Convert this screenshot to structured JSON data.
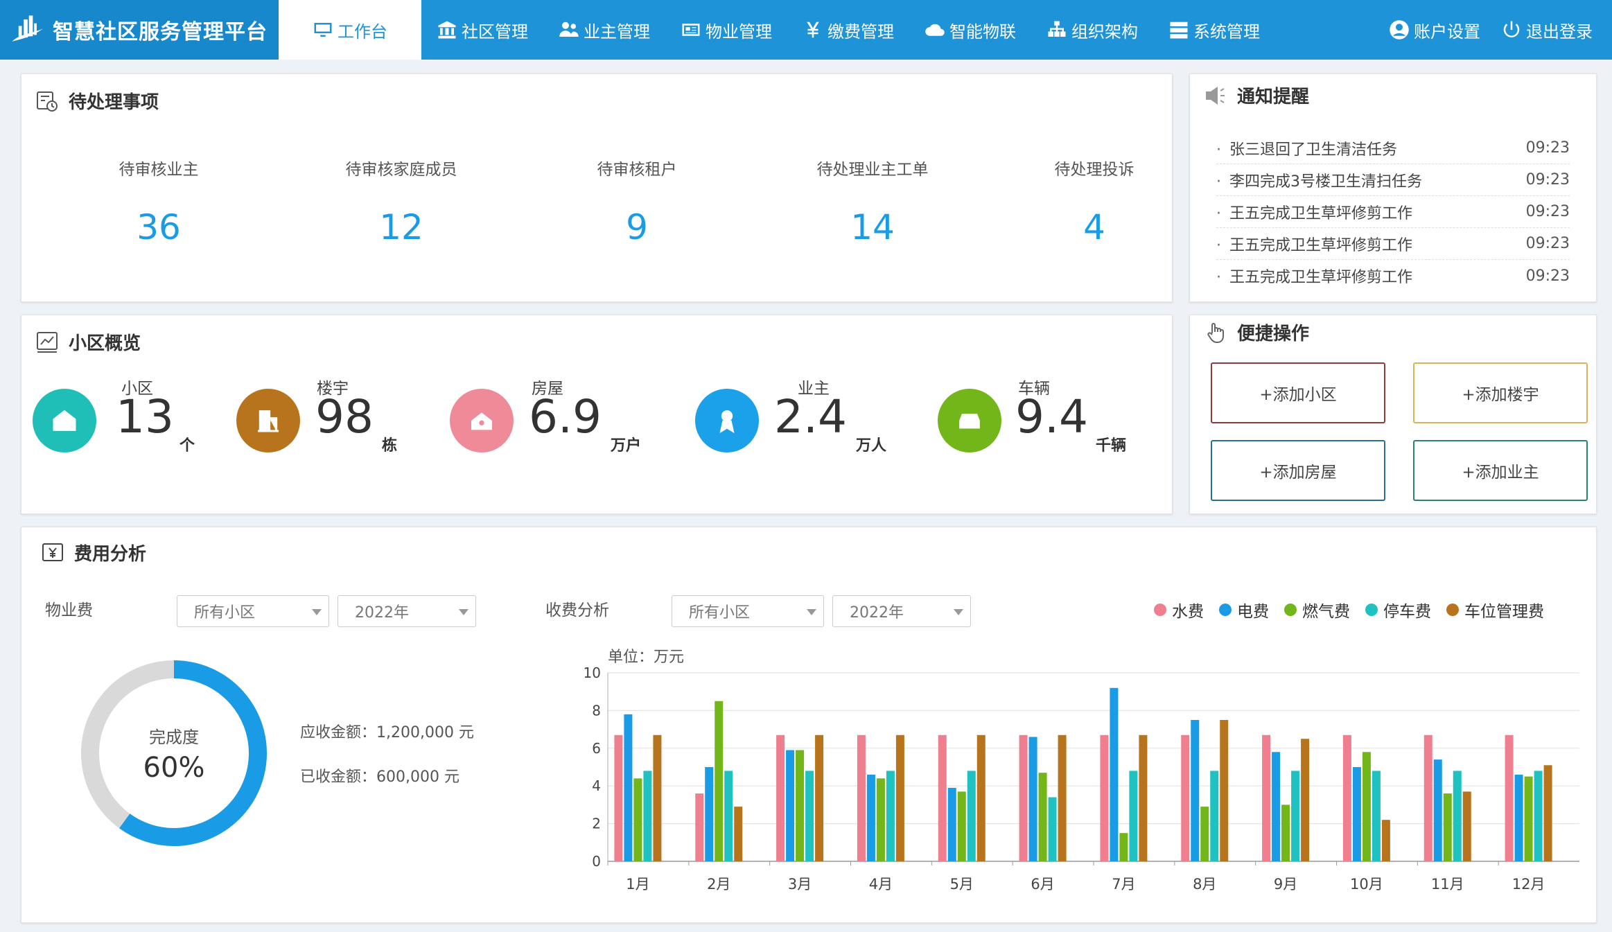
{
  "brand": {
    "title": "智慧社区服务管理平台"
  },
  "nav": {
    "items": [
      {
        "label": "工作台",
        "icon": "monitor-icon",
        "active": true
      },
      {
        "label": "社区管理",
        "icon": "bank-icon"
      },
      {
        "label": "业主管理",
        "icon": "users-icon"
      },
      {
        "label": "物业管理",
        "icon": "newspaper-icon"
      },
      {
        "label": "缴费管理",
        "icon": "yen-icon"
      },
      {
        "label": "智能物联",
        "icon": "cloud-icon"
      },
      {
        "label": "组织架构",
        "icon": "sitemap-icon"
      },
      {
        "label": "系统管理",
        "icon": "server-icon"
      }
    ],
    "account": "账户设置",
    "logout": "退出登录"
  },
  "pending": {
    "title": "待处理事项",
    "items": [
      {
        "label": "待审核业主",
        "value": "36"
      },
      {
        "label": "待审核家庭成员",
        "value": "12"
      },
      {
        "label": "待审核租户",
        "value": "9"
      },
      {
        "label": "待处理业主工单",
        "value": "14"
      },
      {
        "label": "待处理投诉",
        "value": "4"
      }
    ]
  },
  "notice": {
    "title": "通知提醒",
    "items": [
      {
        "text": "张三退回了卫生清洁任务",
        "time": "09:23"
      },
      {
        "text": "李四完成3号楼卫生清扫任务",
        "time": "09:23"
      },
      {
        "text": "王五完成卫生草坪修剪工作",
        "time": "09:23"
      },
      {
        "text": "王五完成卫生草坪修剪工作",
        "time": "09:23"
      },
      {
        "text": "王五完成卫生草坪修剪工作",
        "time": "09:23"
      }
    ]
  },
  "overview": {
    "title": "小区概览",
    "items": [
      {
        "label": "小区",
        "value": "13",
        "unit": "个",
        "color": "#1fbfb8",
        "icon": "home-icon"
      },
      {
        "label": "楼宇",
        "value": "98",
        "unit": "栋",
        "color": "#b8741c",
        "icon": "building-icon"
      },
      {
        "label": "房屋",
        "value": "6.9",
        "unit": "万户",
        "color": "#ef8a98",
        "icon": "house-icon"
      },
      {
        "label": "业主",
        "value": "2.4",
        "unit": "万人",
        "color": "#1aa1ea",
        "icon": "person-icon"
      },
      {
        "label": "车辆",
        "value": "9.4",
        "unit": "千辆",
        "color": "#72b61a",
        "icon": "car-icon"
      }
    ]
  },
  "quick": {
    "title": "便捷操作",
    "buttons": [
      {
        "label": "+添加小区",
        "color": "#8c3a3a"
      },
      {
        "label": "+添加楼宇",
        "color": "#d9b45a"
      },
      {
        "label": "+添加房屋",
        "color": "#2a6d8c"
      },
      {
        "label": "+添加业主",
        "color": "#2a7f78"
      }
    ]
  },
  "fees": {
    "title": "费用分析",
    "property_label": "物业费",
    "community_select": "所有小区",
    "year_select": "2022年",
    "donut": {
      "label": "完成度",
      "value_text": "60%",
      "percent": 60
    },
    "receivable": "应收金额：1,200,000 元",
    "received": "已收金额：600,000 元",
    "collection_label": "收费分析",
    "community_select2": "所有小区",
    "year_select2": "2022年",
    "unit_label": "单位：万元"
  },
  "chart_data": {
    "type": "bar",
    "categories": [
      "1月",
      "2月",
      "3月",
      "4月",
      "5月",
      "6月",
      "7月",
      "8月",
      "9月",
      "10月",
      "11月",
      "12月"
    ],
    "ylim": [
      0,
      10
    ],
    "yticks": [
      "0",
      "2",
      "4",
      "6",
      "8",
      "10"
    ],
    "ylabel": "单位：万元",
    "legend_position": "top-right",
    "grid": true,
    "series": [
      {
        "name": "水费",
        "color": "#ef7f8f",
        "values": [
          6.7,
          3.6,
          6.7,
          6.7,
          6.7,
          6.7,
          6.7,
          6.7,
          6.7,
          6.7,
          6.7,
          6.7
        ]
      },
      {
        "name": "电费",
        "color": "#1a9be6",
        "values": [
          7.8,
          5.0,
          5.9,
          4.6,
          3.9,
          6.6,
          9.2,
          7.5,
          5.8,
          5.0,
          5.4,
          4.6
        ]
      },
      {
        "name": "燃气费",
        "color": "#72b61a",
        "values": [
          4.4,
          8.5,
          5.9,
          4.4,
          3.7,
          4.7,
          1.5,
          2.9,
          3.0,
          5.8,
          3.6,
          4.5
        ]
      },
      {
        "name": "停车费",
        "color": "#1fc2c0",
        "values": [
          4.8,
          4.8,
          4.8,
          4.8,
          4.8,
          3.4,
          4.8,
          4.8,
          4.8,
          4.8,
          4.8,
          4.8
        ]
      },
      {
        "name": "车位管理费",
        "color": "#b8741c",
        "values": [
          6.7,
          2.9,
          6.7,
          6.7,
          6.7,
          6.7,
          6.7,
          7.5,
          6.5,
          2.2,
          3.7,
          5.1
        ]
      }
    ]
  }
}
